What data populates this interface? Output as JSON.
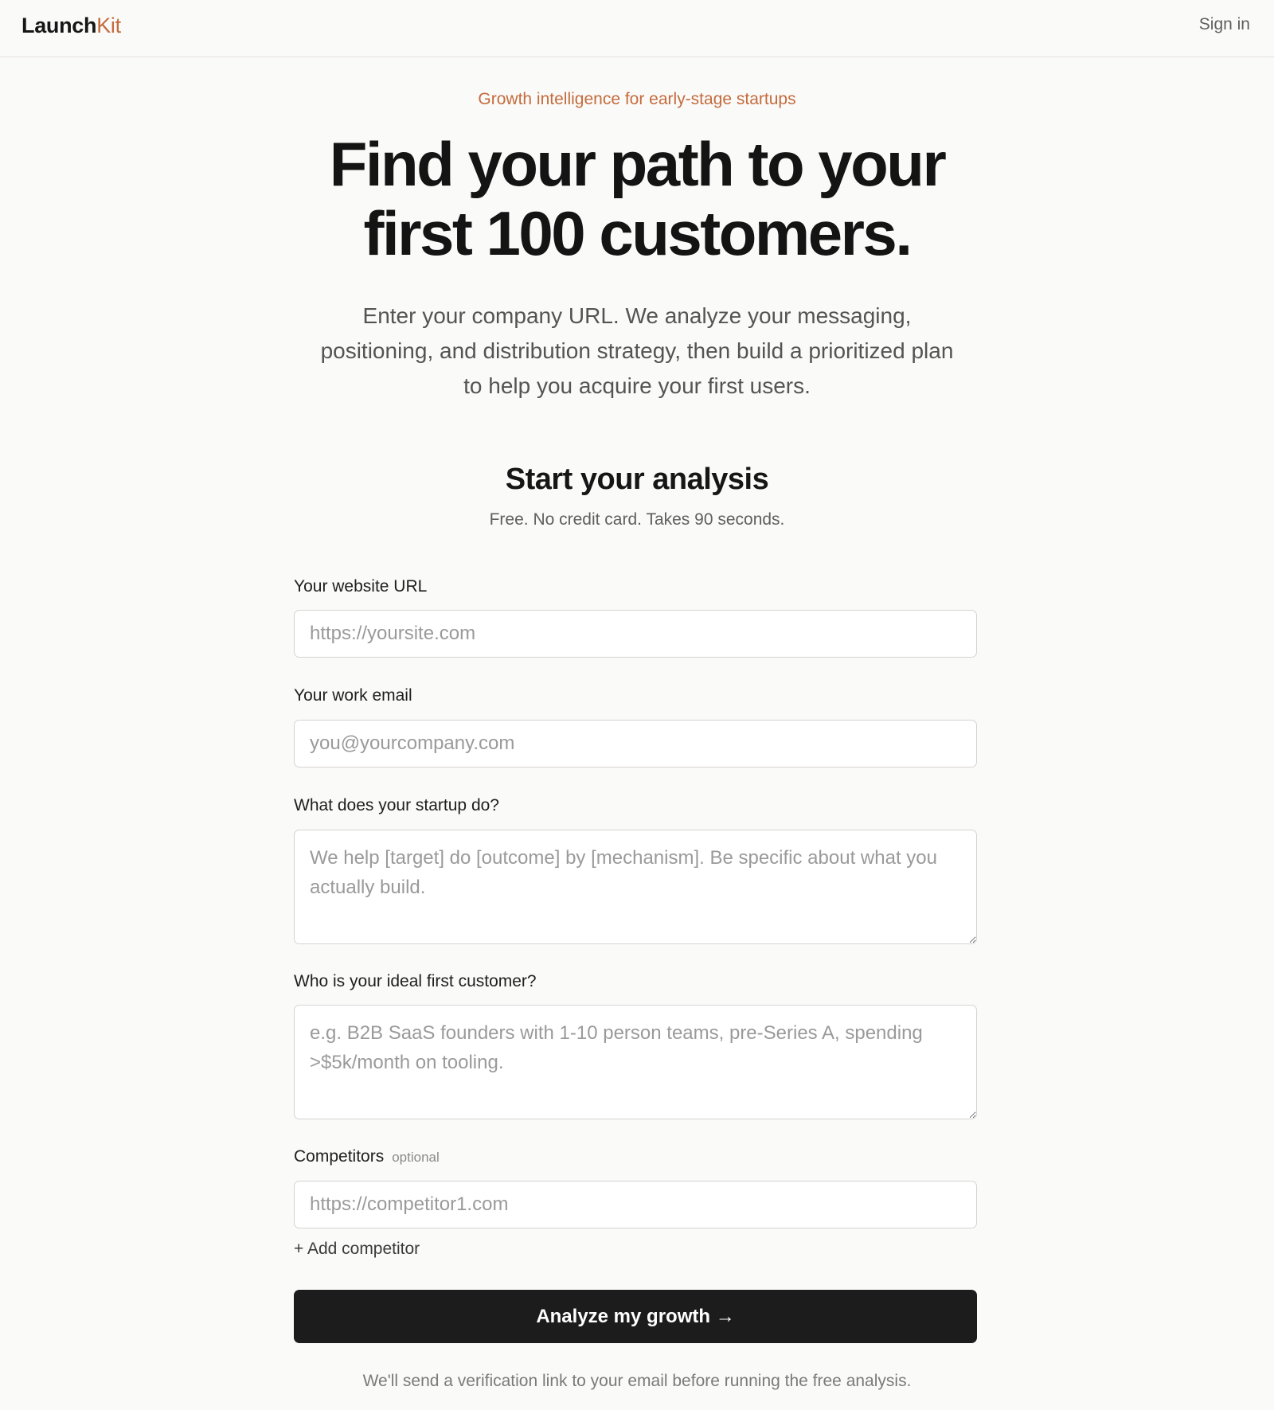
{
  "nav": {
    "brand_part1": "Launch",
    "brand_part2": "Kit",
    "signin_label": "Sign in"
  },
  "hero": {
    "eyebrow": "Growth intelligence for early-stage startups",
    "title_line1": "Find your path to your",
    "title_line2": "first 100 customers.",
    "subtitle": "Enter your company URL. We analyze your messaging, positioning, and distribution strategy, then build a prioritized plan to help you acquire your first users."
  },
  "form": {
    "title": "Start your analysis",
    "subtitle": "Free. No credit card. Takes 90 seconds.",
    "website": {
      "label": "Your website URL",
      "placeholder": "https://yoursite.com",
      "value": ""
    },
    "email": {
      "label": "Your work email",
      "placeholder": "you@yourcompany.com",
      "value": ""
    },
    "description": {
      "label": "What does your startup do?",
      "placeholder": "We help [target] do [outcome] by [mechanism]. Be specific about what you actually build.",
      "value": ""
    },
    "ideal_customer": {
      "label": "Who is your ideal first customer?",
      "placeholder": "e.g. B2B SaaS founders with 1-10 person teams, pre-Series A, spending >$5k/month on tooling.",
      "value": ""
    },
    "competitors": {
      "label": "Competitors",
      "optional_tag": "optional",
      "placeholder": "https://competitor1.com",
      "value": ""
    },
    "add_competitor_label": "+ Add competitor",
    "submit_label": "Analyze my growth →",
    "footnote": "We'll send a verification link to your email before running the free analysis."
  },
  "colors": {
    "accent": "#c46c3d",
    "background": "#fafaf9",
    "button": "#1c1c1c",
    "border": "#d6d4d0"
  }
}
